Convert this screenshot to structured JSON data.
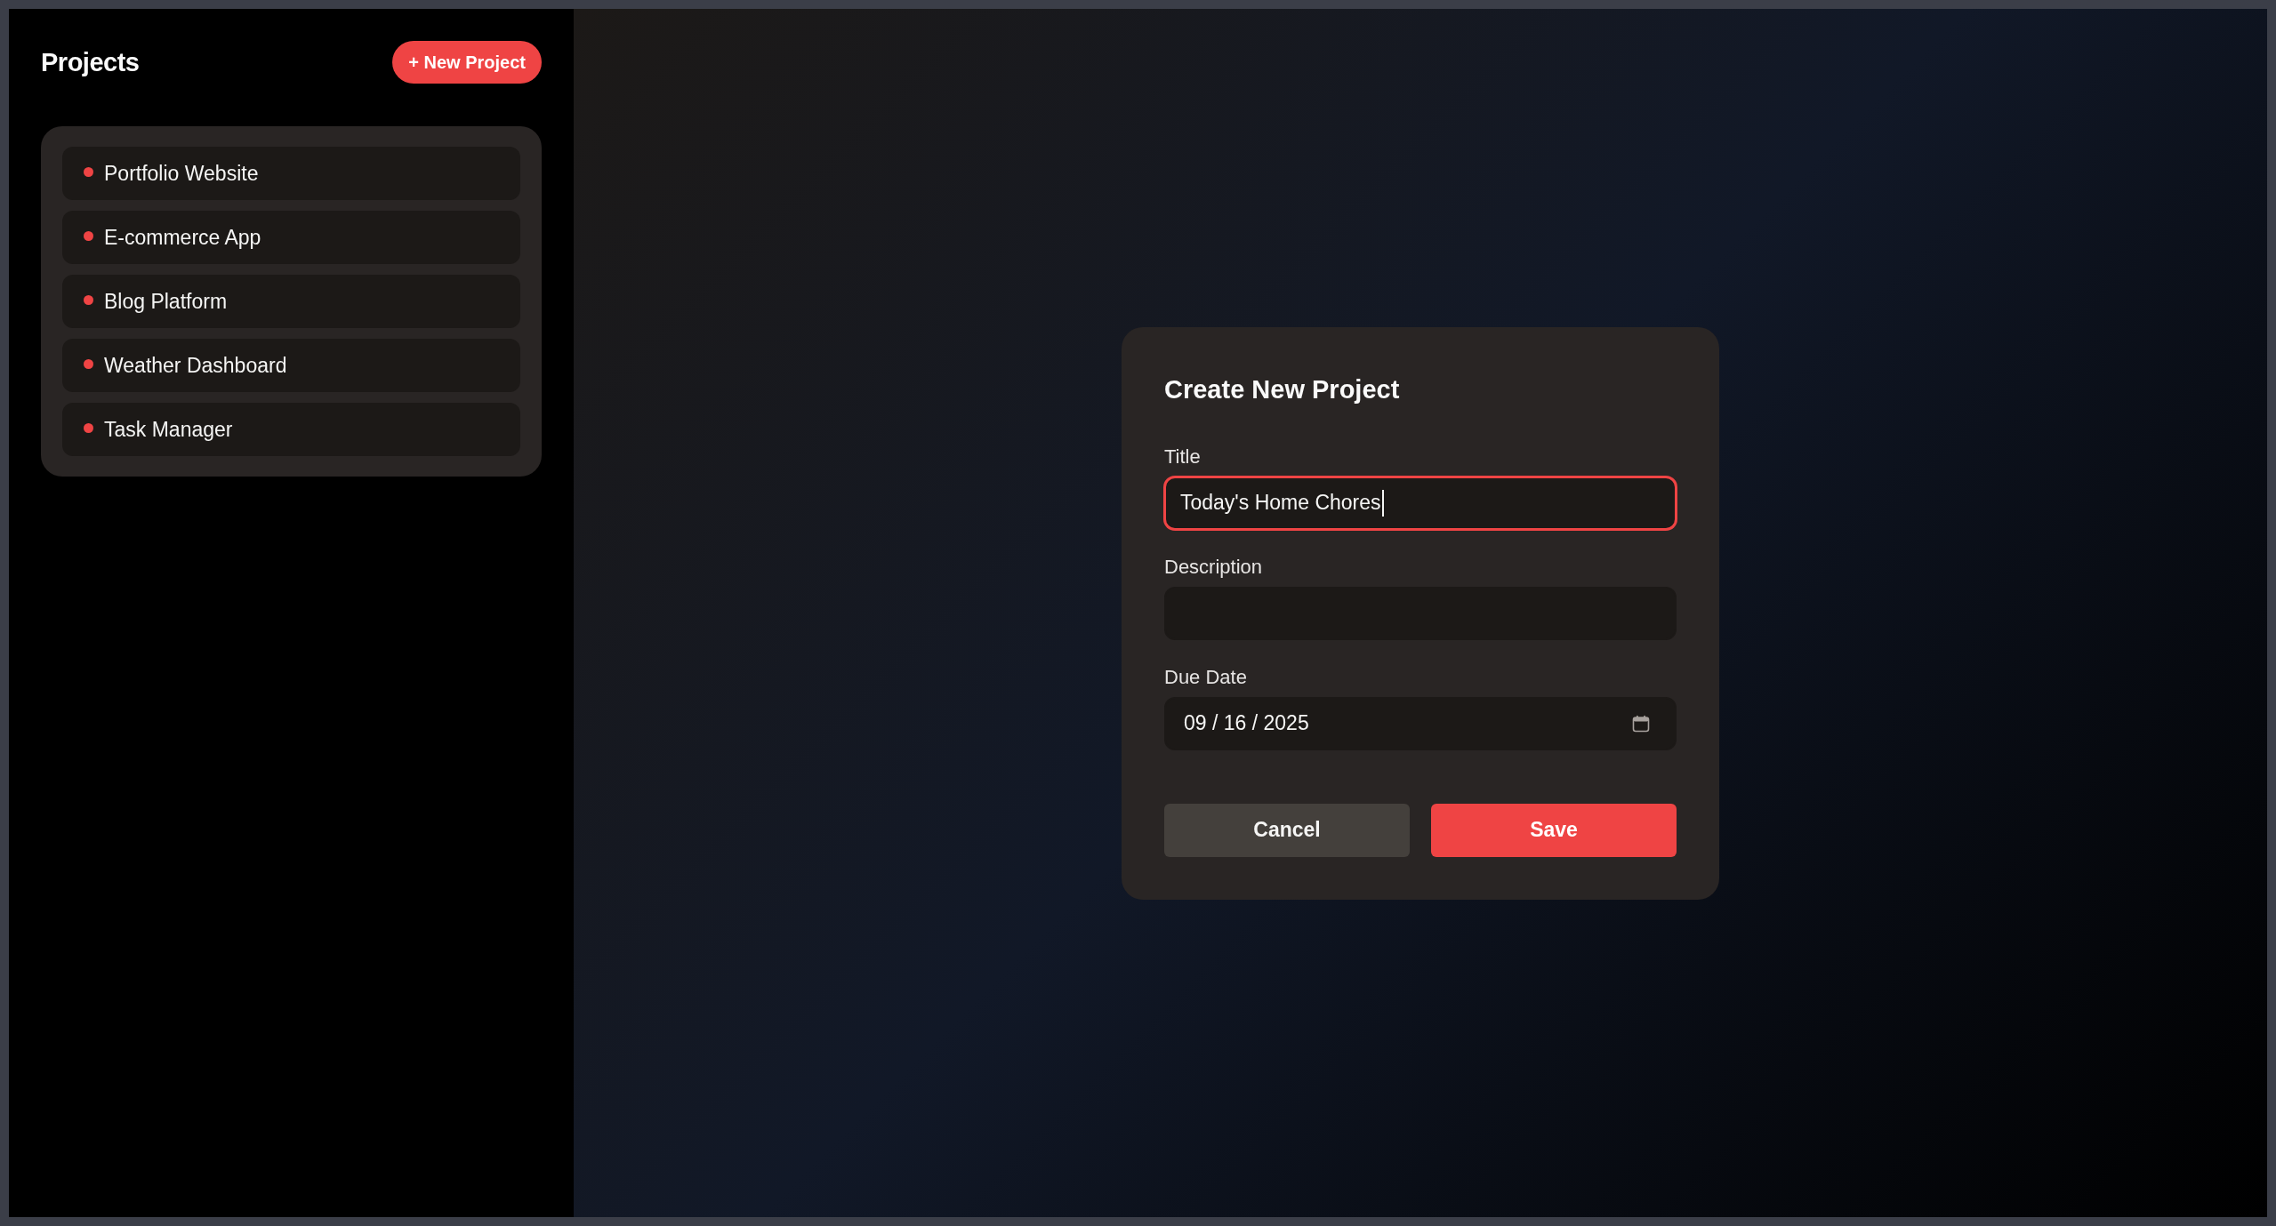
{
  "sidebar": {
    "title": "Projects",
    "new_button": {
      "label": "+ New Project"
    },
    "projects": [
      {
        "name": "Portfolio Website"
      },
      {
        "name": "E-commerce App"
      },
      {
        "name": "Blog Platform"
      },
      {
        "name": "Weather Dashboard"
      },
      {
        "name": "Task Manager"
      }
    ]
  },
  "dialog": {
    "title": "Create New Project",
    "fields": [
      {
        "kind": "text",
        "label": "Title",
        "value": "Today's Home Chores",
        "focused": true
      },
      {
        "kind": "text",
        "label": "Description",
        "focused": false
      },
      {
        "kind": "date",
        "label": "Due Date",
        "value": "09 / 16 / 2025",
        "focused": false
      }
    ],
    "buttons": [
      {
        "kind": "secondary",
        "label": "Cancel"
      },
      {
        "kind": "primary",
        "label": "Save"
      }
    ]
  }
}
